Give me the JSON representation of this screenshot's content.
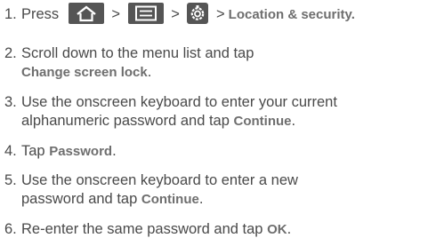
{
  "steps": [
    {
      "number": "1.",
      "prefix": "Press",
      "separators": [
        ">",
        ">",
        ">"
      ],
      "icons": [
        "home-icon",
        "menu-icon",
        "settings-icon"
      ],
      "term": "Location & security",
      "suffix": "."
    },
    {
      "number": "2.",
      "line1": "Scroll down to the menu list and tap",
      "term": "Change screen lock",
      "suffix": "."
    },
    {
      "number": "3.",
      "line1": "Use the onscreen keyboard to enter your current",
      "line2_prefix": "alphanumeric password and tap",
      "term": "Continue",
      "suffix": "."
    },
    {
      "number": "4.",
      "prefix": "Tap",
      "term": "Password",
      "suffix": "."
    },
    {
      "number": "5.",
      "line1": "Use the onscreen keyboard to enter a new",
      "line2_prefix": "password and tap",
      "term": "Continue",
      "suffix": "."
    },
    {
      "number": "6.",
      "prefix": "Re-enter the same password and tap",
      "term": "OK",
      "suffix": "."
    }
  ]
}
